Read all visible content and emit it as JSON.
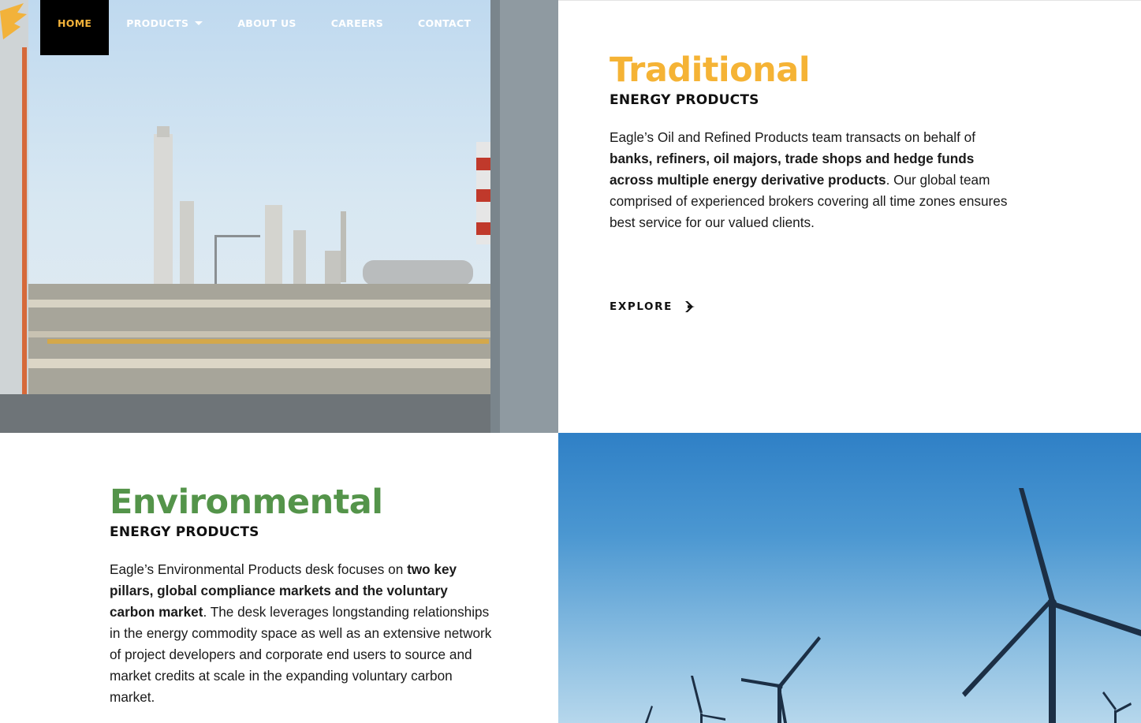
{
  "nav": {
    "items": [
      {
        "label": "HOME",
        "active": true
      },
      {
        "label": "PRODUCTS",
        "has_dropdown": true
      },
      {
        "label": "ABOUT US"
      },
      {
        "label": "CAREERS"
      },
      {
        "label": "CONTACT"
      }
    ],
    "active_color": "#f2b23a"
  },
  "traditional": {
    "title": "Traditional",
    "subtitle": "ENERGY PRODUCTS",
    "text_before": "Eagle’s Oil and Refined Products team transacts on behalf of ",
    "text_bold": "banks, refiners, oil majors, trade shops and hedge funds across multiple energy derivative products",
    "text_after": ". Our global team comprised of experienced brokers covering all time zones ensures best service for our valued clients.",
    "cta": "EXPLORE",
    "accent": "#f5b335"
  },
  "environmental": {
    "title": "Environmental",
    "subtitle": "ENERGY PRODUCTS",
    "text_before": "Eagle’s Environmental Products desk focuses on ",
    "text_bold": "two key pillars, global compliance markets and the voluntary carbon market",
    "text_after": ". The desk leverages longstanding relationships in the energy commodity space as well as an extensive network of project developers and corporate end users to source and market credits at scale in the expanding voluntary carbon market.",
    "accent": "#54944a"
  },
  "icons": {
    "explore_arrow": "arrow-right-icon",
    "logo": "eagle-wing-icon",
    "dropdown": "chevron-down-icon"
  }
}
